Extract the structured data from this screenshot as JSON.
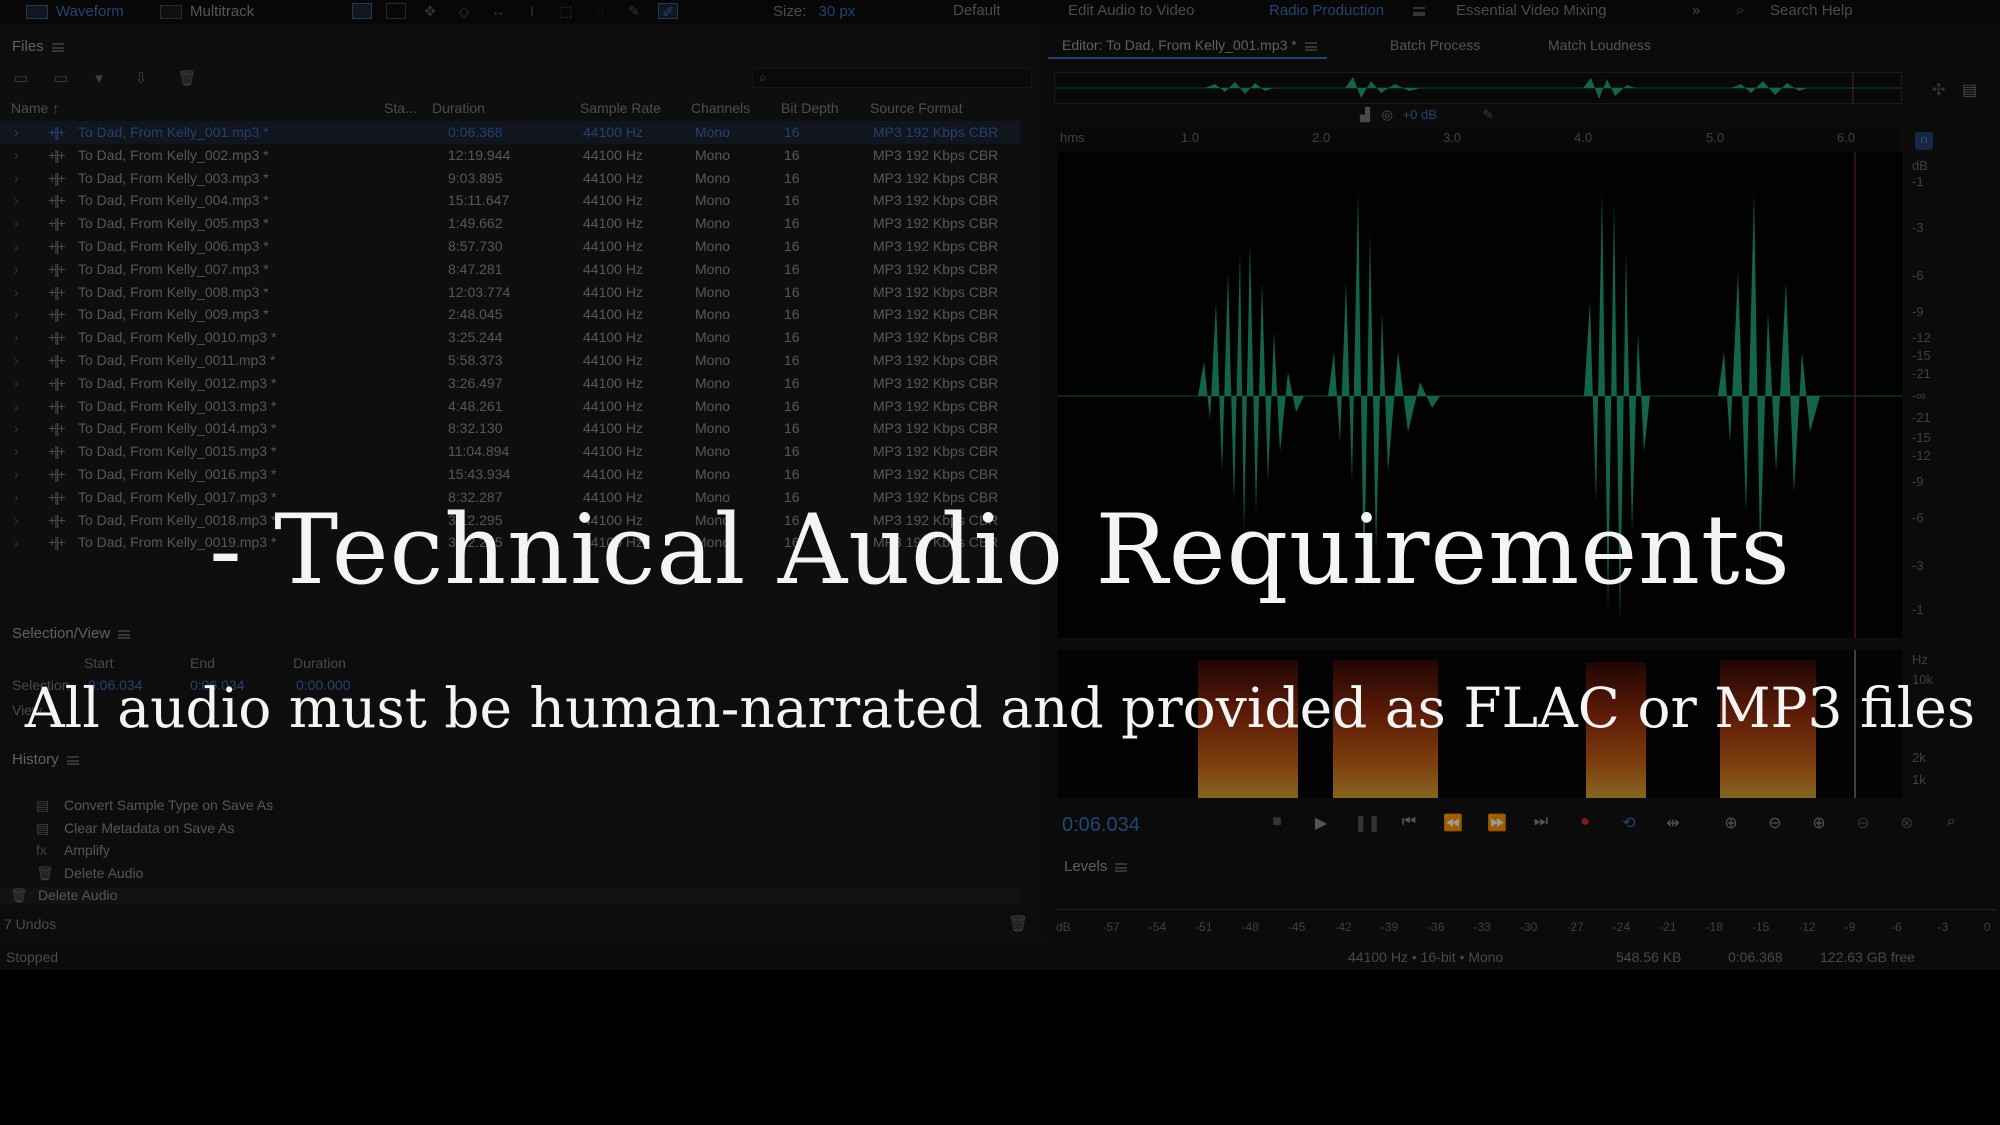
{
  "topbar": {
    "view_waveform": "Waveform",
    "view_multitrack": "Multitrack",
    "size_label": "Size:",
    "size_value": "30 px",
    "workspaces": [
      "Default",
      "Edit Audio to Video",
      "Radio Production",
      "Essential Video Mixing"
    ],
    "active_workspace": "Radio Production",
    "search_placeholder": "Search Help"
  },
  "files_panel": {
    "title": "Files",
    "columns": [
      "Name",
      "Sta...",
      "Duration",
      "Sample Rate",
      "Channels",
      "Bit Depth",
      "Source Format"
    ],
    "rows": [
      {
        "name": "To Dad, From Kelly_001.mp3 *",
        "duration": "0:06.368",
        "rate": "44100 Hz",
        "channels": "Mono",
        "bits": "16",
        "format": "MP3 192 Kbps CBR",
        "selected": true
      },
      {
        "name": "To Dad, From Kelly_002.mp3 *",
        "duration": "12:19.944",
        "rate": "44100 Hz",
        "channels": "Mono",
        "bits": "16",
        "format": "MP3 192 Kbps CBR"
      },
      {
        "name": "To Dad, From Kelly_003.mp3 *",
        "duration": "9:03.895",
        "rate": "44100 Hz",
        "channels": "Mono",
        "bits": "16",
        "format": "MP3 192 Kbps CBR"
      },
      {
        "name": "To Dad, From Kelly_004.mp3 *",
        "duration": "15:11.647",
        "rate": "44100 Hz",
        "channels": "Mono",
        "bits": "16",
        "format": "MP3 192 Kbps CBR"
      },
      {
        "name": "To Dad, From Kelly_005.mp3 *",
        "duration": "1:49.662",
        "rate": "44100 Hz",
        "channels": "Mono",
        "bits": "16",
        "format": "MP3 192 Kbps CBR"
      },
      {
        "name": "To Dad, From Kelly_006.mp3 *",
        "duration": "8:57.730",
        "rate": "44100 Hz",
        "channels": "Mono",
        "bits": "16",
        "format": "MP3 192 Kbps CBR"
      },
      {
        "name": "To Dad, From Kelly_007.mp3 *",
        "duration": "8:47.281",
        "rate": "44100 Hz",
        "channels": "Mono",
        "bits": "16",
        "format": "MP3 192 Kbps CBR"
      },
      {
        "name": "To Dad, From Kelly_008.mp3 *",
        "duration": "12:03.774",
        "rate": "44100 Hz",
        "channels": "Mono",
        "bits": "16",
        "format": "MP3 192 Kbps CBR"
      },
      {
        "name": "To Dad, From Kelly_009.mp3 *",
        "duration": "2:48.045",
        "rate": "44100 Hz",
        "channels": "Mono",
        "bits": "16",
        "format": "MP3 192 Kbps CBR"
      },
      {
        "name": "To Dad, From Kelly_0010.mp3 *",
        "duration": "3:25.244",
        "rate": "44100 Hz",
        "channels": "Mono",
        "bits": "16",
        "format": "MP3 192 Kbps CBR"
      },
      {
        "name": "To Dad, From Kelly_0011.mp3 *",
        "duration": "5:58.373",
        "rate": "44100 Hz",
        "channels": "Mono",
        "bits": "16",
        "format": "MP3 192 Kbps CBR"
      },
      {
        "name": "To Dad, From Kelly_0012.mp3 *",
        "duration": "3:26.497",
        "rate": "44100 Hz",
        "channels": "Mono",
        "bits": "16",
        "format": "MP3 192 Kbps CBR"
      },
      {
        "name": "To Dad, From Kelly_0013.mp3 *",
        "duration": "4:48.261",
        "rate": "44100 Hz",
        "channels": "Mono",
        "bits": "16",
        "format": "MP3 192 Kbps CBR"
      },
      {
        "name": "To Dad, From Kelly_0014.mp3 *",
        "duration": "8:32.130",
        "rate": "44100 Hz",
        "channels": "Mono",
        "bits": "16",
        "format": "MP3 192 Kbps CBR"
      },
      {
        "name": "To Dad, From Kelly_0015.mp3 *",
        "duration": "11:04.894",
        "rate": "44100 Hz",
        "channels": "Mono",
        "bits": "16",
        "format": "MP3 192 Kbps CBR"
      },
      {
        "name": "To Dad, From Kelly_0016.mp3 *",
        "duration": "15:43.934",
        "rate": "44100 Hz",
        "channels": "Mono",
        "bits": "16",
        "format": "MP3 192 Kbps CBR"
      },
      {
        "name": "To Dad, From Kelly_0017.mp3 *",
        "duration": "8:32.287",
        "rate": "44100 Hz",
        "channels": "Mono",
        "bits": "16",
        "format": "MP3 192 Kbps CBR"
      },
      {
        "name": "To Dad, From Kelly_0018.mp3 *",
        "duration": "3:12.295",
        "rate": "44100 Hz",
        "channels": "Mono",
        "bits": "16",
        "format": "MP3 192 Kbps CBR"
      },
      {
        "name": "To Dad, From Kelly_0019.mp3 *",
        "duration": "3:12.295",
        "rate": "44100 Hz",
        "channels": "Mono",
        "bits": "16",
        "format": "MP3 192 Kbps CBR"
      }
    ]
  },
  "selection_view": {
    "title": "Selection/View",
    "headers": [
      "Start",
      "End",
      "Duration"
    ],
    "selection_label": "Selection",
    "view_label": "View",
    "selection_start": "0:06.034",
    "selection_end": "0:06.034",
    "selection_duration": "0:00.000"
  },
  "history": {
    "title": "History",
    "items": [
      {
        "icon": "document-icon",
        "label": "Convert Sample Type on Save As"
      },
      {
        "icon": "document-icon",
        "label": "Clear Metadata on Save As"
      },
      {
        "icon": "fx-icon",
        "label": "Amplify"
      },
      {
        "icon": "trash-icon",
        "label": "Delete Audio"
      },
      {
        "icon": "trash-icon",
        "label": "Delete Audio"
      }
    ],
    "undos": "7 Undos"
  },
  "status": {
    "state": "Stopped",
    "format": "44100 Hz • 16-bit • Mono",
    "size": "548.56 KB",
    "duration": "0:06.368",
    "free": "122.63 GB free"
  },
  "editor": {
    "tab_title": "Editor: To Dad, From Kelly_001.mp3 *",
    "tabs": [
      "Batch Process",
      "Match Loudness"
    ],
    "hud_gain": "+0 dB",
    "ruler_unit": "hms",
    "ruler_ticks": [
      "1.0",
      "2.0",
      "3.0",
      "4.0",
      "5.0",
      "6.0"
    ],
    "db_unit": "dB",
    "db_ticks": [
      "-1",
      "-3",
      "-6",
      "-9",
      "-12",
      "-15",
      "-21",
      "-∞",
      "-21",
      "-15",
      "-12",
      "-9",
      "-6",
      "-3",
      "-1"
    ],
    "hz_unit": "Hz",
    "hz_ticks": [
      "10k",
      "2k",
      "1k"
    ],
    "timecode": "0:06.034"
  },
  "levels": {
    "title": "Levels",
    "scale": [
      "dB",
      "-57",
      "-54",
      "-51",
      "-48",
      "-45",
      "-42",
      "-39",
      "-36",
      "-33",
      "-30",
      "-27",
      "-24",
      "-21",
      "-18",
      "-15",
      "-12",
      "-9",
      "-6",
      "-3",
      "0"
    ]
  },
  "overlay": {
    "heading": "- Technical Audio Requirements",
    "subheading": "All audio must be human-narrated and provided as FLAC or MP3 files"
  },
  "colors": {
    "accent": "#3b6db8",
    "waveform": "#1fa07c",
    "record": "#d22b2b"
  }
}
